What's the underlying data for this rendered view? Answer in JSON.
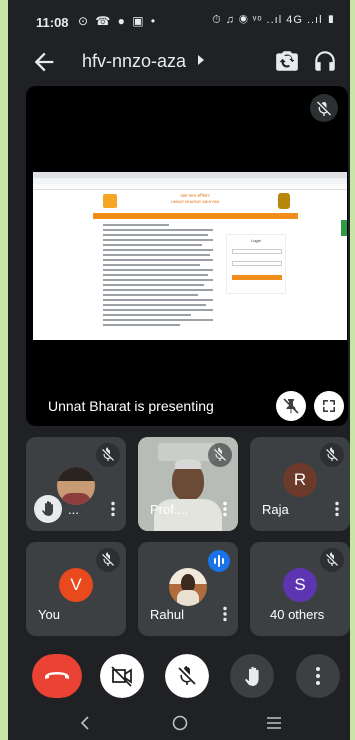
{
  "status_bar": {
    "time": "11:08",
    "left_icons": "⊙ ☎ ● ▣ •",
    "right_icons": "⏱ ♫ ◉ ᵛᵒ ..ıl 4G ..ıl ▮"
  },
  "top_bar": {
    "meeting_code": "hfv-nnzo-aza"
  },
  "presentation": {
    "label": "Unnat Bharat is presenting",
    "site_name_hindi": "उन्नत भारत अभियान",
    "site_name": "UNNAT BHARAT ABHIYAN",
    "login_title": "Login"
  },
  "participants": [
    {
      "name": "...",
      "kind": "photo",
      "muted": true,
      "hand_raised": true
    },
    {
      "name": "Prof....",
      "kind": "video",
      "muted": true
    },
    {
      "name": "Raja",
      "kind": "initial",
      "initial": "R",
      "color": "#6b3a2a",
      "muted": true
    },
    {
      "name": "You",
      "kind": "initial",
      "initial": "V",
      "color": "#e8491d",
      "muted": true
    },
    {
      "name": "Rahul",
      "kind": "photo",
      "speaking": true
    },
    {
      "name": "40 others",
      "kind": "initial",
      "initial": "S",
      "color": "#5e35b1",
      "muted": true
    }
  ],
  "colors": {
    "background": "#202124",
    "tile": "#3c4043",
    "end_call": "#ea4335",
    "speaking": "#8ab4f8"
  },
  "icons": {
    "back": "arrow-left-icon",
    "switch_camera": "switch-camera-icon",
    "audio": "headphones-icon",
    "mic_off": "mic-off-icon",
    "pin": "pin-off-icon",
    "fullscreen": "fullscreen-icon",
    "end_call": "phone-hangup-icon",
    "camera_off": "camera-off-icon",
    "raise_hand": "hand-icon",
    "more": "more-vert-icon"
  }
}
